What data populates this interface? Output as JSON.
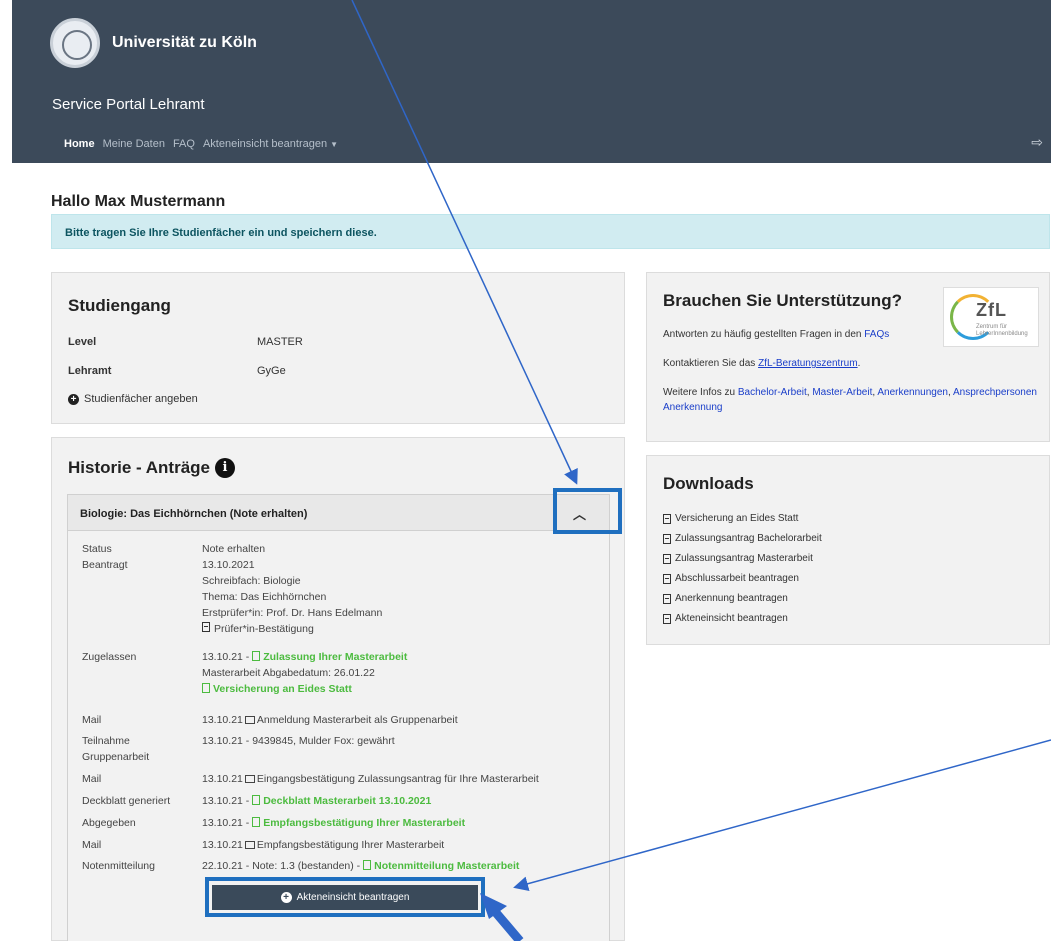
{
  "header": {
    "university": "Universität zu Köln",
    "portal": "Service Portal Lehramt",
    "nav": {
      "home": "Home",
      "my_data": "Meine Daten",
      "faq": "FAQ",
      "files": "Akteneinsicht beantragen"
    }
  },
  "greeting": "Hallo Max Mustermann",
  "alert": "Bitte tragen Sie Ihre Studienfächer ein und speichern diese.",
  "studiengang": {
    "title": "Studiengang",
    "level_label": "Level",
    "level_value": "MASTER",
    "lehramt_label": "Lehramt",
    "lehramt_value": "GyGe",
    "add_subjects": "Studienfächer angeben"
  },
  "support": {
    "title": "Brauchen Sie Unterstützung?",
    "faq_text": "Antworten zu häufig gestellten Fragen in den",
    "faq_link": "FAQs",
    "contact_text": "Kontaktieren Sie das",
    "contact_link": "ZfL-Beratungszentrum",
    "contact_end": ".",
    "info_text": "Weitere Infos zu",
    "info_links": [
      "Bachelor-Arbeit",
      "Master-Arbeit",
      "Anerkennungen",
      "Ansprechpersonen Anerkennung"
    ],
    "logo_text": "ZfL",
    "logo_sub1": "Zentrum für",
    "logo_sub2": "LehrerInnenbildung"
  },
  "downloads": {
    "title": "Downloads",
    "items": [
      "Versicherung an Eides Statt",
      "Zulassungsantrag Bachelorarbeit",
      "Zulassungsantrag Masterarbeit",
      "Abschlussarbeit beantragen",
      "Anerkennung beantragen",
      "Akteneinsicht beantragen"
    ]
  },
  "historie": {
    "title": "Historie - Anträge",
    "accordion_title": "Biologie: Das Eichhörnchen (Note erhalten)",
    "rows": {
      "status_label": "Status",
      "status_value": "Note erhalten",
      "beantragt_label": "Beantragt",
      "beantragt_date": "13.10.2021",
      "beantragt_fach": "Schreibfach: Biologie",
      "beantragt_thema": "Thema: Das Eichhörnchen",
      "beantragt_pruefer": "Erstprüfer*in: Prof. Dr. Hans Edelmann",
      "beantragt_doc": "Prüfer*in-Bestätigung",
      "zugelassen_label": "Zugelassen",
      "zugelassen_date": "13.10.21 -",
      "zugelassen_link": "Zulassung Ihrer Masterarbeit",
      "zugelassen_abgabe": "Masterarbeit Abgabedatum: 26.01.22",
      "zugelassen_eides": "Versicherung an Eides Statt",
      "mail1_label": "Mail",
      "mail1_date": "13.10.21",
      "mail1_text": "Anmeldung Masterarbeit als Gruppenarbeit",
      "teilnahme_label1": "Teilnahme",
      "teilnahme_label2": "Gruppenarbeit",
      "teilnahme_value": "13.10.21 - 9439845, Mulder Fox: gewährt",
      "mail2_label": "Mail",
      "mail2_date": "13.10.21",
      "mail2_text": "Eingangsbestätigung Zulassungsantrag für Ihre Masterarbeit",
      "deckblatt_label": "Deckblatt generiert",
      "deckblatt_date": "13.10.21 -",
      "deckblatt_link": "Deckblatt Masterarbeit 13.10.2021",
      "abgegeben_label": "Abgegeben",
      "abgegeben_date": "13.10.21 -",
      "abgegeben_link": "Empfangsbestätigung Ihrer Masterarbeit",
      "mail3_label": "Mail",
      "mail3_date": "13.10.21",
      "mail3_text": "Empfangsbestätigung Ihrer Masterarbeit",
      "note_label": "Notenmitteilung",
      "note_value": "22.10.21 - Note: 1.3 (bestanden) -",
      "note_link": "Notenmitteilung Masterarbeit"
    },
    "action_button": "Akteneinsicht beantragen"
  },
  "colors": {
    "header_bg": "#3c4a5a",
    "alert_bg": "#d1ecf1",
    "link": "#1a3ec9",
    "success": "#4cbb3f",
    "annotation": "#1f6fbf"
  }
}
